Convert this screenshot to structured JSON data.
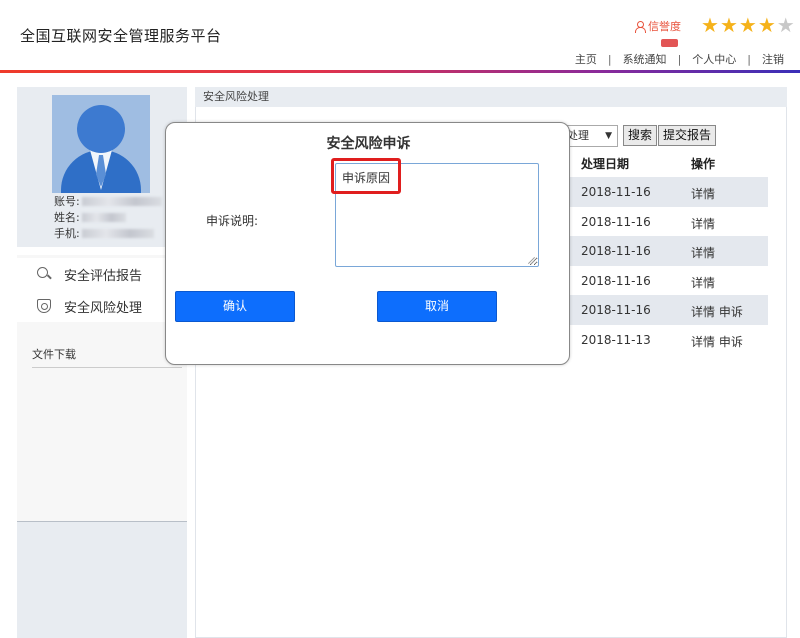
{
  "header": {
    "app_title": "全国互联网安全管理服务平台",
    "credit_label": "信誉度",
    "stars": {
      "filled": 4,
      "total": 5
    },
    "nav": [
      "主页",
      "系统通知",
      "个人中心",
      "注销"
    ],
    "nav_sep": "|"
  },
  "colors": {
    "accent": "#0d6efd",
    "credit": "#e8513a",
    "star": "#f5b21a",
    "highlight": "#e01e1e"
  },
  "profile": {
    "account_label": "账号:",
    "name_label": "姓名:",
    "phone_label": "手机:"
  },
  "sidebar": {
    "items": [
      {
        "label": "安全评估报告",
        "icon": "search-icon"
      },
      {
        "label": "安全风险处理",
        "icon": "shield-icon"
      }
    ],
    "downloads_label": "文件下载"
  },
  "main": {
    "panel_title": "安全风险处理",
    "filter_select_value": "处理",
    "search_button": "搜索",
    "submit_report_button": "提交报告",
    "columns": [
      "处理日期",
      "操作"
    ],
    "rows": [
      {
        "date": "2018-11-16",
        "action": "详情"
      },
      {
        "date": "2018-11-16",
        "action": "详情"
      },
      {
        "date": "2018-11-16",
        "action": "详情"
      },
      {
        "date": "2018-11-16",
        "action": "详情"
      },
      {
        "date": "2018-11-16",
        "action": "详情 申诉"
      },
      {
        "date": "2018-11-13",
        "action": "详情 申诉"
      }
    ]
  },
  "modal": {
    "title": "安全风险申诉",
    "label": "申诉说明:",
    "textarea_value": "申诉原因",
    "confirm": "确认",
    "cancel": "取消"
  }
}
